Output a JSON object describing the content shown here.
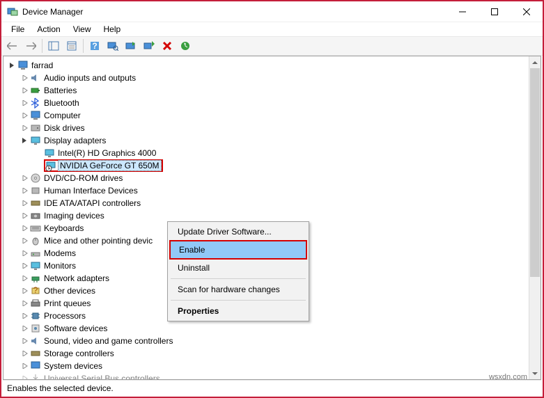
{
  "titlebar": {
    "title": "Device Manager"
  },
  "menubar": {
    "items": [
      "File",
      "Action",
      "View",
      "Help"
    ]
  },
  "tree": {
    "root": "farrad",
    "nodes": [
      {
        "label": "Audio inputs and outputs",
        "icon": "audio"
      },
      {
        "label": "Batteries",
        "icon": "battery"
      },
      {
        "label": "Bluetooth",
        "icon": "bluetooth"
      },
      {
        "label": "Computer",
        "icon": "computer"
      },
      {
        "label": "Disk drives",
        "icon": "disk"
      },
      {
        "label": "Display adapters",
        "icon": "display",
        "expanded": true,
        "children": [
          {
            "label": "Intel(R) HD Graphics 4000",
            "icon": "display"
          },
          {
            "label": "NVIDIA GeForce GT 650M",
            "icon": "display-disabled",
            "selected": true
          }
        ]
      },
      {
        "label": "DVD/CD-ROM drives",
        "icon": "dvd"
      },
      {
        "label": "Human Interface Devices",
        "icon": "hid"
      },
      {
        "label": "IDE ATA/ATAPI controllers",
        "icon": "ide"
      },
      {
        "label": "Imaging devices",
        "icon": "camera"
      },
      {
        "label": "Keyboards",
        "icon": "keyboard"
      },
      {
        "label": "Mice and other pointing devic",
        "icon": "mouse"
      },
      {
        "label": "Modems",
        "icon": "modem"
      },
      {
        "label": "Monitors",
        "icon": "monitor"
      },
      {
        "label": "Network adapters",
        "icon": "network"
      },
      {
        "label": "Other devices",
        "icon": "other"
      },
      {
        "label": "Print queues",
        "icon": "printer"
      },
      {
        "label": "Processors",
        "icon": "cpu"
      },
      {
        "label": "Software devices",
        "icon": "software"
      },
      {
        "label": "Sound, video and game controllers",
        "icon": "sound"
      },
      {
        "label": "Storage controllers",
        "icon": "storage"
      },
      {
        "label": "System devices",
        "icon": "system"
      },
      {
        "label": "Universal Serial Bus controllers",
        "icon": "usb"
      }
    ]
  },
  "context_menu": {
    "items": [
      {
        "label": "Update Driver Software...",
        "type": "item"
      },
      {
        "label": "Enable",
        "type": "item",
        "highlighted": true,
        "boxed": true
      },
      {
        "label": "Uninstall",
        "type": "item"
      },
      {
        "type": "sep"
      },
      {
        "label": "Scan for hardware changes",
        "type": "item"
      },
      {
        "type": "sep"
      },
      {
        "label": "Properties",
        "type": "item",
        "bold": true
      }
    ]
  },
  "statusbar": {
    "text": "Enables the selected device."
  },
  "watermark": "wsxdn.com"
}
